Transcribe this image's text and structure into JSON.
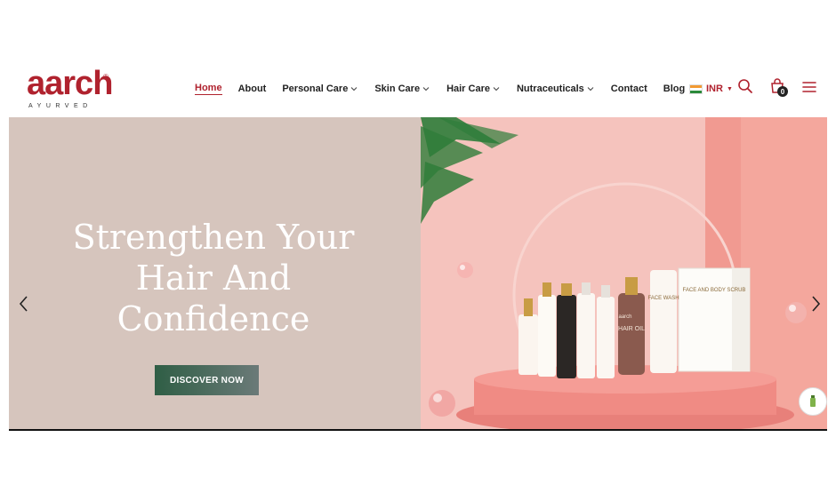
{
  "brand": {
    "logo_word": "aarch",
    "logo_reg": "®",
    "logo_tagline": "AYURVED",
    "color": "#b0222e"
  },
  "nav": {
    "items": [
      {
        "label": "Home",
        "active": true,
        "dropdown": false
      },
      {
        "label": "About",
        "active": false,
        "dropdown": false
      },
      {
        "label": "Personal Care",
        "active": false,
        "dropdown": true
      },
      {
        "label": "Skin Care",
        "active": false,
        "dropdown": true
      },
      {
        "label": "Hair Care",
        "active": false,
        "dropdown": true
      },
      {
        "label": "Nutraceuticals",
        "active": false,
        "dropdown": true
      },
      {
        "label": "Contact",
        "active": false,
        "dropdown": false
      },
      {
        "label": "Blog",
        "active": false,
        "dropdown": false
      }
    ]
  },
  "tools": {
    "currency": "INR",
    "cart_count": "0",
    "icons": [
      "india-flag-icon",
      "search-icon",
      "cart-icon",
      "menu-icon"
    ]
  },
  "hero": {
    "headline_line1": "Strengthen Your",
    "headline_line2": "Hair And",
    "headline_line3": "Confidence",
    "cta_label": "DISCOVER NOW",
    "left_bg": "#d6c5bd",
    "right_bg": "#f2b3ae",
    "products": [
      {
        "label": "aarch"
      },
      {
        "label": "HAIR OIL"
      },
      {
        "label": "FACE WASH"
      },
      {
        "label": "FACE AND BODY SCRUB"
      }
    ]
  }
}
